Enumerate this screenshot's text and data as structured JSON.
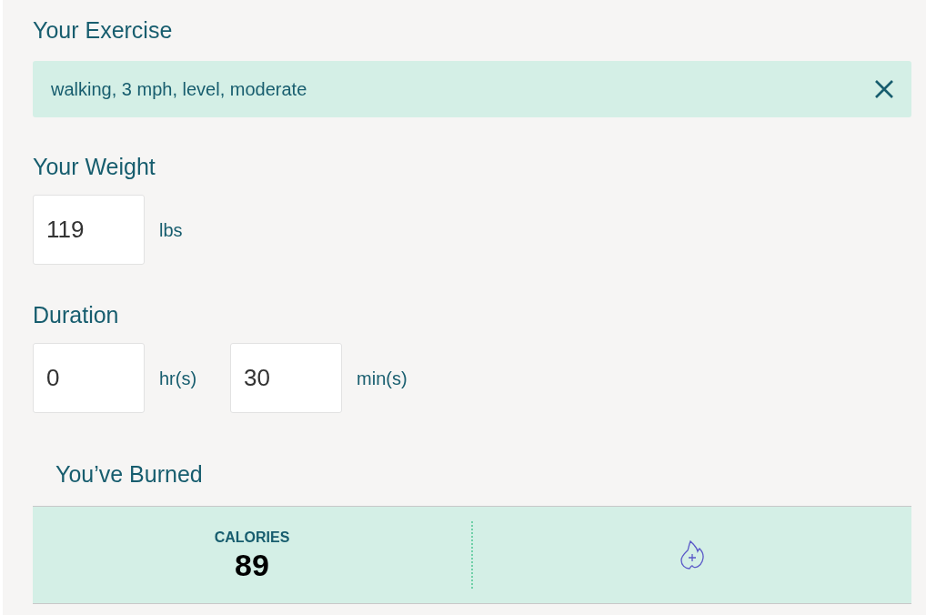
{
  "exercise": {
    "label": "Your Exercise",
    "value": "walking, 3 mph, level, moderate"
  },
  "weight": {
    "label": "Your Weight",
    "fields": [
      {
        "value": "119",
        "unit": "lbs"
      }
    ]
  },
  "duration": {
    "label": "Duration",
    "fields": [
      {
        "value": "0",
        "unit": "hr(s)"
      },
      {
        "value": "30",
        "unit": "min(s)"
      }
    ]
  },
  "result": {
    "label": "You’ve Burned",
    "metric": "CALORIES",
    "value": "89"
  }
}
